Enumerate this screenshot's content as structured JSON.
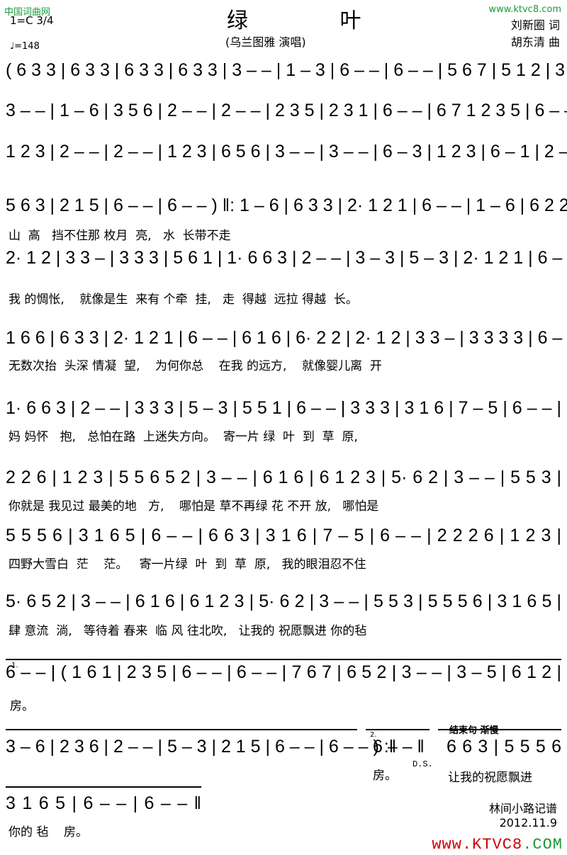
{
  "watermarks": {
    "left": "中国词曲网",
    "right": "www.ktvc8.com",
    "bottom_prefix": "www.",
    "bottom_brand": "KTVC8",
    ".com": ".COM"
  },
  "header": {
    "title": "绿 叶",
    "performer": "(乌兰图雅 演唱)",
    "lyricist": "刘新圈 词",
    "composer": "胡东清 曲",
    "key": "1=C 3/4",
    "tempo": "♩=148"
  },
  "score": [
    {
      "notes": "( 6 3 3 | 6 3 3 | 6 3 3 | 6 3 3 | 3 – – | 1 – 3 | 6 – – | 6 – – | 5 6 7 | 5 1 2 | 3 – – |",
      "lyrics": ""
    },
    {
      "notes": "3 – – | 1 – 6 | 3 5 6 | 2 – – | 2 – – | 2 3 5 | 2 3 1 | 6 – – | 6 7 1 2 3 5 | 6 – – |",
      "lyrics": ""
    },
    {
      "notes": "1 2 3 | 2 – – | 2 – – | 1 2 3 | 6 5 6 | 3 – – | 3 – – | 6 – 3 | 1 2 3 | 6 – 1 | 2 – – |",
      "lyrics": ""
    },
    {
      "notes": "5 6 3 | 2 1 5 | 6 – – | 6 – – ) ‖: 1 – 6 | 6 3 3 | 2· 1 2 1 | 6 – – | 1 – 6 | 6 2 2 |",
      "lyrics": "山  高   挡不住那 枚月  亮,   水  长带不走"
    },
    {
      "notes": "2· 1 2 | 3 3 – | 3 3 3 | 5 6 1 | 1· 6 6 3 | 2 – – | 3 – 3 | 5 – 3 | 2· 1 2 1 | 6 – – |",
      "lyrics": "我 的惆怅,    就像是生  来有 个牵  挂,   走  得越  远拉 得越  长。"
    },
    {
      "notes": "1 6 6 | 6 3 3 | 2· 1 2 1 | 6 – – | 6 1 6 | 6· 2 2 | 2· 1 2 | 3 3 – | 3 3 3 3 | 6 – 1 |",
      "lyrics": "无数次抬  头深 情凝  望,    为何你总    在我 的远方,    就像婴儿离  开"
    },
    {
      "notes": "1· 6 6 3 | 2 – – | 3 3 3 | 5 – 3 | 5 5 1 | 6 – – | 3 3 3 | 3 1 6 | 7 – 5 | 6 – – |",
      "lyrics": "妈 妈怀   抱,   总怕在路  上迷失方向。  寄一片 绿  叶  到  草  原,"
    },
    {
      "notes": "2 2 6 | 1 2 3 | 5 5 6 5 2 | 3 – – | 6 1 6 | 6 1 2 3 | 5· 6 2 | 3 – – | 5 5 3 |",
      "lyrics": "你就是 我见过 最美的地   方,    哪怕是 草不再绿 花 不开 放,   哪怕是"
    },
    {
      "notes": "5 5 5 6 | 3 1 6 5 | 6 – – | 6 6 3 | 3 1 6 | 7 – 5 | 6 – – | 2 2 2 6 | 1 2 3 |",
      "lyrics": "四野大雪白  茫    茫。   寄一片绿  叶  到  草  原,   我的眼泪忍不住"
    },
    {
      "notes": "5· 6 5 2 | 3 – – | 6 1 6 | 6 1 2 3 | 5· 6 2 | 3 – – | 5 5 3 | 5 5 5 6 | 3 1 6 5 |",
      "lyrics": "肆 意流  淌,   等待着 春来  临 风 往北吹,   让我的 祝愿飘进 你的毡"
    },
    {
      "notes": "6 – – | ( 1 6 1 | 2 3 5 | 6 – – | 6 – – | 7 6 7 | 6 5 2 | 3 – – | 3 – 5 | 6 1 2 |",
      "lyrics": "房。",
      "volta": "1."
    },
    {
      "notes": "3 – 6 | 2 3 6 | 2 – – | 5 – 3 | 2 1 5 | 6 – – | 6 – – ) :‖",
      "lyrics": ""
    },
    {
      "notes": "3 1 6 5 | 6 – – | 6 – – ‖",
      "lyrics": "你的 毡    房。"
    }
  ],
  "ending2": {
    "volta": "2.",
    "notes": "6 – – ‖",
    "lyrics": "房。",
    "ds": "D.S."
  },
  "coda": {
    "label": "结束句 渐慢",
    "notes": "6 6 3 | 5 5 5 6",
    "lyrics": "让我的祝愿飘进"
  },
  "footer": {
    "transcriber": "林间小路记谱",
    "date": "2012.11.9"
  }
}
